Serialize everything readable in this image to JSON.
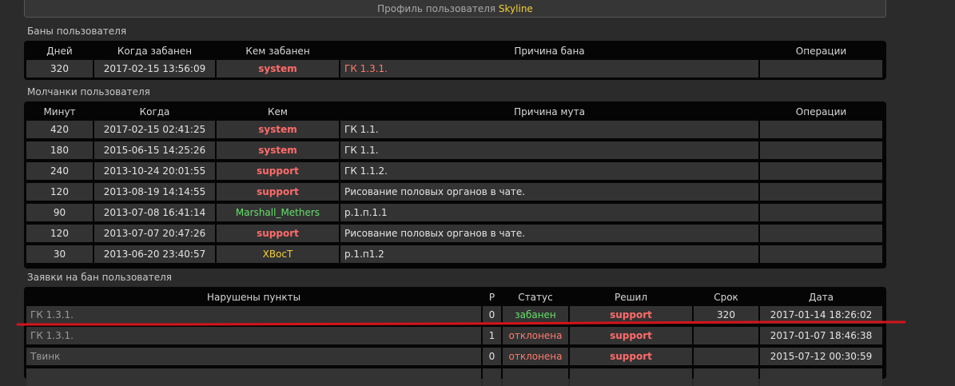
{
  "profile": {
    "title_prefix": "Профиль пользователя",
    "username": "Skyline"
  },
  "bans": {
    "section_title": "Баны пользователя",
    "headers": [
      "Дней",
      "Когда забанен",
      "Кем забанен",
      "Причина бана",
      "Операции"
    ],
    "rows": [
      {
        "days": "320",
        "when": "2017-02-15 13:56:09",
        "by": "system",
        "reason": "ГК 1.3.1.",
        "ops": ""
      }
    ]
  },
  "mutes": {
    "section_title": "Молчанки пользователя",
    "headers": [
      "Минут",
      "Когда",
      "Кем",
      "Причина мута",
      "Операции"
    ],
    "rows": [
      {
        "minutes": "420",
        "when": "2017-02-15 02:41:25",
        "by": "system",
        "by_color": "red",
        "reason": "ГК 1.1.",
        "ops": ""
      },
      {
        "minutes": "180",
        "when": "2015-06-15 14:25:26",
        "by": "system",
        "by_color": "red",
        "reason": "ГК 1.1.",
        "ops": ""
      },
      {
        "minutes": "240",
        "when": "2013-10-24 20:01:55",
        "by": "support",
        "by_color": "red",
        "reason": "ГК 1.1.2.",
        "ops": ""
      },
      {
        "minutes": "120",
        "when": "2013-08-19 14:14:55",
        "by": "support",
        "by_color": "red",
        "reason": "Рисование половых органов в чате.",
        "ops": ""
      },
      {
        "minutes": "90",
        "when": "2013-07-08 16:41:14",
        "by": "Marshall_Methers",
        "by_color": "green",
        "reason": "р.1.п.1.1",
        "ops": ""
      },
      {
        "minutes": "120",
        "when": "2013-07-07 20:47:26",
        "by": "support",
        "by_color": "red",
        "reason": "Рисование половых органов в чате.",
        "ops": ""
      },
      {
        "minutes": "30",
        "when": "2013-06-20 23:40:57",
        "by": "XBocT",
        "by_color": "yellow",
        "reason": "р.1.п1.2",
        "ops": ""
      }
    ]
  },
  "ban_requests": {
    "section_title": "Заявки на бан пользователя",
    "headers": [
      "Нарушены пункты",
      "Р",
      "Статус",
      "Решил",
      "Срок",
      "Дата"
    ],
    "rows": [
      {
        "points": "ГК 1.3.1.",
        "r": "0",
        "status": "забанен",
        "status_color": "green",
        "decided": "support",
        "term": "320",
        "date": "2017-01-14 18:26:02"
      },
      {
        "points": "ГК 1.3.1.",
        "r": "1",
        "status": "отклонена",
        "status_color": "red",
        "decided": "support",
        "term": "",
        "date": "2017-01-07 18:46:38"
      },
      {
        "points": "Твинк",
        "r": "0",
        "status": "отклонена",
        "status_color": "red",
        "decided": "support",
        "term": "",
        "date": "2015-07-12 00:30:59"
      },
      {
        "points": "",
        "r": "",
        "status": "",
        "status_color": "red",
        "decided": "",
        "term": "",
        "date": ""
      }
    ]
  },
  "colors": {
    "annotation_line": "#d4141a",
    "name_red": "#ff6b6b",
    "name_green": "#64e06a",
    "name_yellow": "#f2cf3a"
  }
}
